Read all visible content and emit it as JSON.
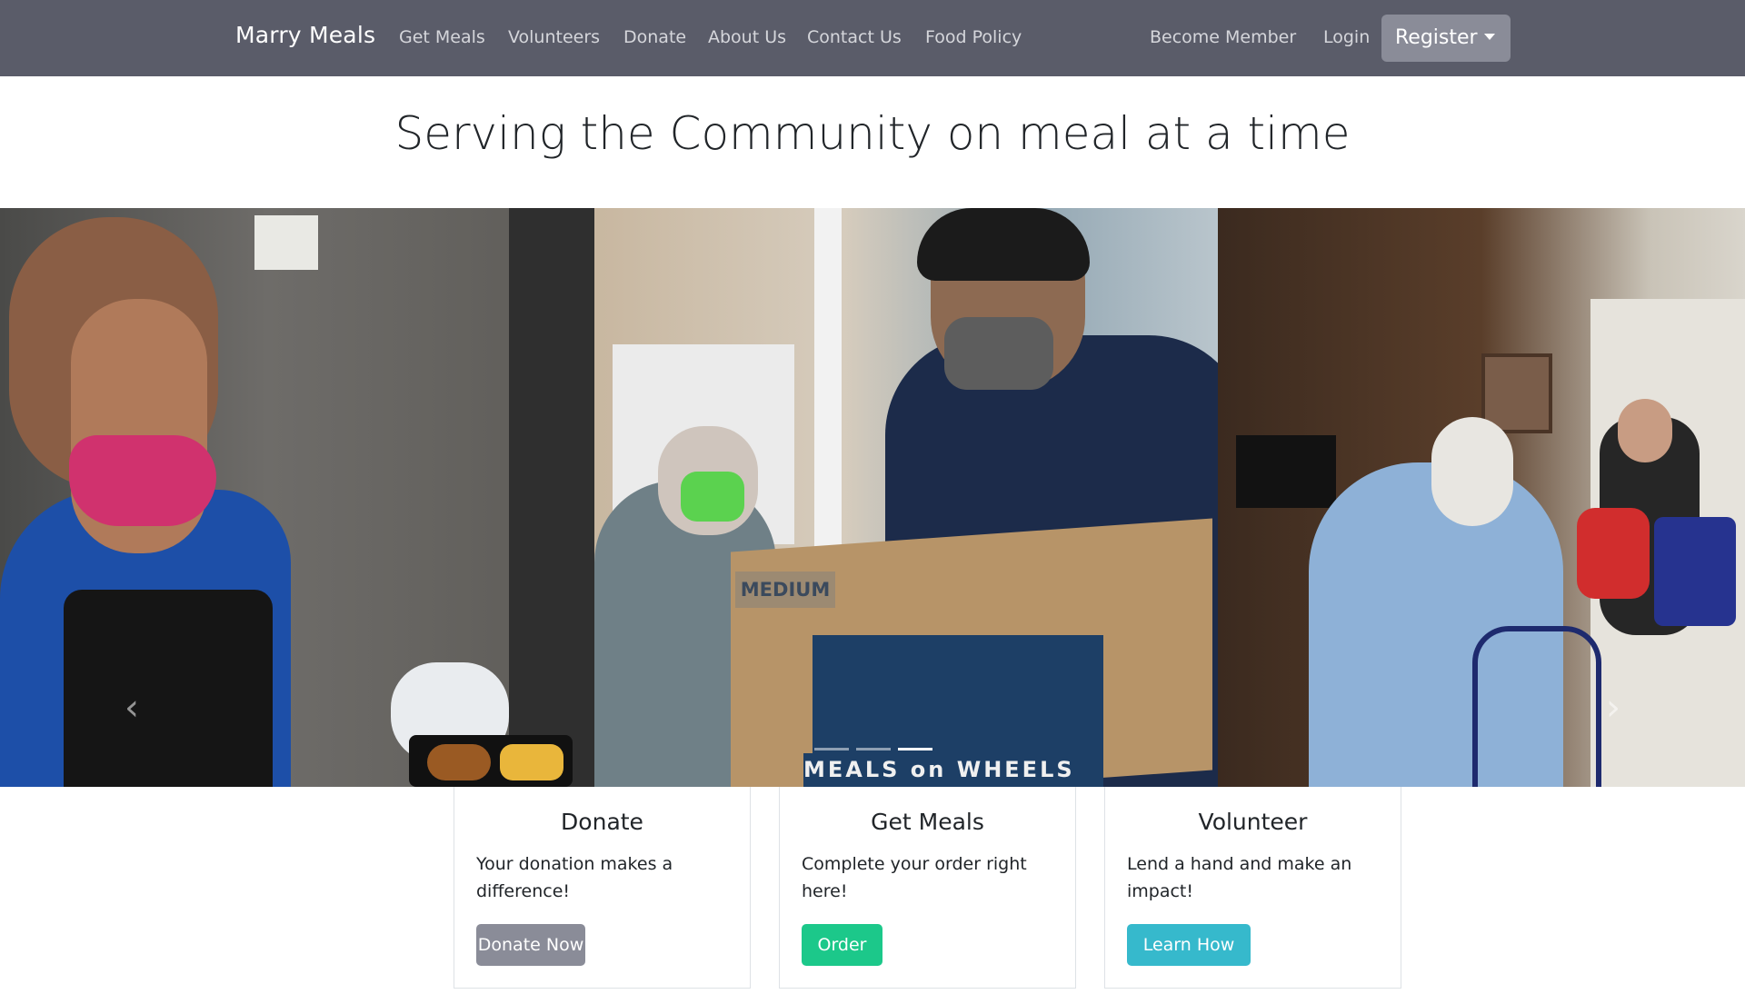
{
  "navbar": {
    "brand": "Marry Meals",
    "links": [
      "Get Meals",
      "Volunteers",
      "Donate",
      "About Us",
      "Contact Us",
      "Food Policy"
    ],
    "right_links": [
      "Become Member",
      "Login"
    ],
    "register_label": "Register"
  },
  "hero": {
    "headline": "Serving the Community on meal at a time"
  },
  "carousel": {
    "box_label": "MEDIUM",
    "box_brand": "MEALS on WHEELS"
  },
  "cards": [
    {
      "title": "Donate",
      "text": "Your donation makes a difference!",
      "button": "Donate Now",
      "button_color": "#8a8c98"
    },
    {
      "title": "Get Meals",
      "text": "Complete your order right here!",
      "button": "Order",
      "button_color": "#1cc88a"
    },
    {
      "title": "Volunteer",
      "text": "Lend a hand and make an impact!",
      "button": "Learn How",
      "button_color": "#36b9cc"
    }
  ],
  "colors": {
    "navbar_bg": "#5a5c69",
    "register_bg": "#8a8c98"
  }
}
